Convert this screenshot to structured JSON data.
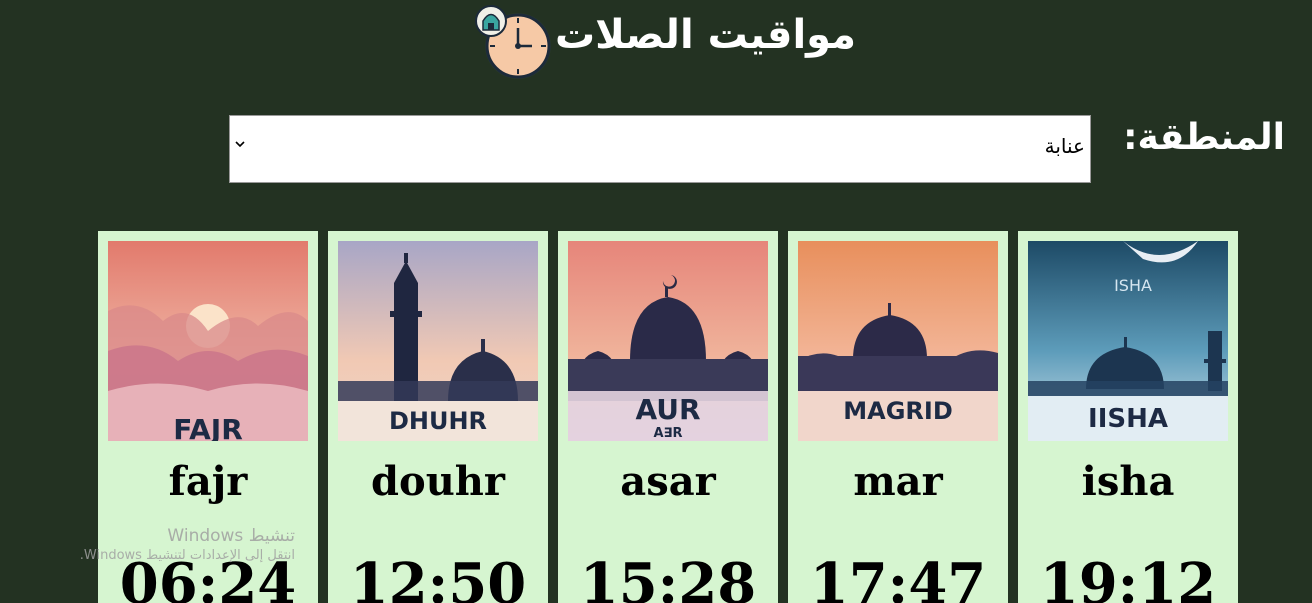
{
  "header": {
    "title": "مواقيت الصلات",
    "icon": "mosque-clock-icon"
  },
  "region": {
    "label": "المنطقة:",
    "selected": "عنابة"
  },
  "prayers": [
    {
      "name": "fajr",
      "time": "06:24",
      "image_text": "FAJR",
      "icon": "sunrise-icon"
    },
    {
      "name": "douhr",
      "time": "12:50",
      "image_text": "DHUHR",
      "icon": "minaret-icon"
    },
    {
      "name": "asar",
      "time": "15:28",
      "image_text": "AUR",
      "image_subtext": "A∃R",
      "icon": "crescent-mosque-icon"
    },
    {
      "name": "mar",
      "time": "17:47",
      "image_text": "MAGRID",
      "icon": "mosque-sunset-icon"
    },
    {
      "name": "isha",
      "time": "19:12",
      "image_text": "IISHA",
      "image_top_text": "ISHA",
      "icon": "moon-mosque-icon"
    }
  ],
  "watermark": {
    "title": "تنشيط Windows",
    "subtitle": "انتقل إلى الإعدادات لتنشيط Windows."
  },
  "colors": {
    "background": "#233222",
    "card": "#d6f5d0",
    "title_text": "#ffffff"
  }
}
